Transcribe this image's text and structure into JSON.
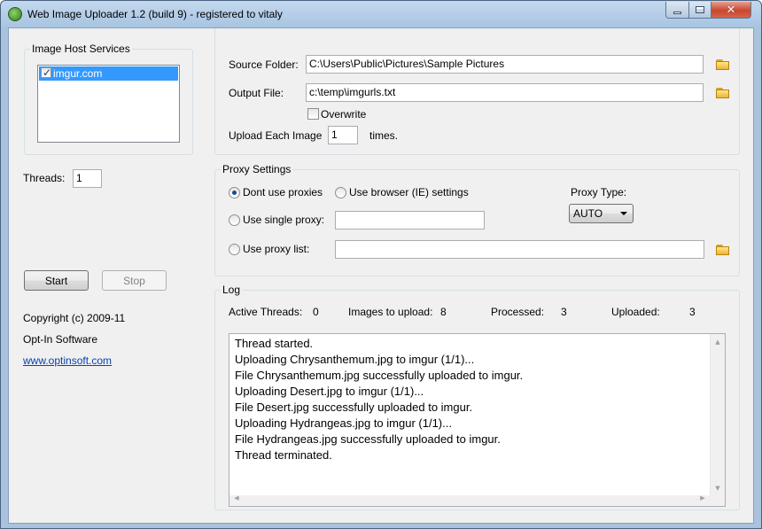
{
  "window": {
    "title": "Web Image Uploader 1.2 (build 9) - registered to vitaly"
  },
  "host_services": {
    "group_label": "Image Host Services",
    "items": [
      {
        "label": "imgur.com",
        "checked": true,
        "selected": true
      }
    ]
  },
  "threads": {
    "label": "Threads:",
    "value": "1"
  },
  "buttons": {
    "start": "Start",
    "stop": "Stop"
  },
  "about": {
    "copyright": "Copyright (c) 2009-11",
    "company": "Opt-In Software",
    "website": "www.optinsoft.com"
  },
  "files": {
    "source_label": "Source Folder:",
    "source_value": "C:\\Users\\Public\\Pictures\\Sample Pictures",
    "output_label": "Output File:",
    "output_value": "c:\\temp\\imgurls.txt",
    "overwrite_label": "Overwrite",
    "overwrite_checked": false,
    "upload_each_label": "Upload Each Image",
    "upload_each_value": "1",
    "times_label": "times."
  },
  "proxy": {
    "group_label": "Proxy Settings",
    "dont_use": "Dont use proxies",
    "use_browser": "Use browser (IE) settings",
    "use_single": "Use single proxy:",
    "use_list": "Use proxy list:",
    "selected_option": "Dont use proxies",
    "single_value": "",
    "list_value": "",
    "type_label": "Proxy Type:",
    "type_value": "AUTO"
  },
  "log": {
    "group_label": "Log",
    "stats": {
      "active_threads_label": "Active Threads:",
      "active_threads_value": "0",
      "images_label": "Images to upload:",
      "images_value": "8",
      "processed_label": "Processed:",
      "processed_value": "3",
      "uploaded_label": "Uploaded:",
      "uploaded_value": "3"
    },
    "lines": [
      "Thread started.",
      "Uploading Chrysanthemum.jpg to imgur (1/1)...",
      "File Chrysanthemum.jpg successfully uploaded to imgur.",
      "Uploading Desert.jpg to imgur (1/1)...",
      "File Desert.jpg successfully uploaded to imgur.",
      "Uploading Hydrangeas.jpg to imgur (1/1)...",
      "File Hydrangeas.jpg successfully uploaded to imgur.",
      "Thread terminated."
    ]
  },
  "icons": {
    "app": "app-globe-icon",
    "folder": "folder-open-icon",
    "minimize": "minimize-icon",
    "maximize": "maximize-icon",
    "close": "close-icon"
  }
}
